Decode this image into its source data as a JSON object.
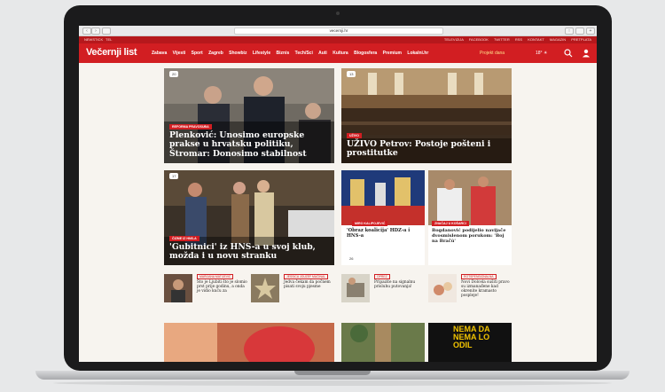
{
  "browser": {
    "url": "vecernji.hr"
  },
  "topbar": {
    "left": "NEWSTICK",
    "left2": "TEL",
    "right": [
      "TELEVIZIJA",
      "FACEBOOK",
      "TWITTER",
      "RSS",
      "KONTAKT",
      "MAGAZIN",
      "PRETPLATA"
    ]
  },
  "header": {
    "logo": "Večernji list",
    "nav": [
      "Zabava",
      "Vijesti",
      "Sport",
      "Zagreb",
      "Showbiz",
      "Lifestyle",
      "Biznis",
      "Tech/Sci",
      "Auti",
      "Kultura",
      "Blogosfera",
      "Premium",
      "Lokalni.hr"
    ],
    "projekt": "Projekt dana",
    "weather": "18°"
  },
  "articles": {
    "a1": {
      "tag": "REFORMA PRAVOSUĐA",
      "title": "Plenković: Unosimo europske prakse u hrvatsku politiku, Štromar: Donosimo stabilnost",
      "count": "20"
    },
    "a2": {
      "tag": "UŽIVO",
      "title": "UŽIVO Petrov: Postoje pošteni i prostitutke",
      "count": "13"
    },
    "a3": {
      "tag": "ČIZME IZ HNS-A",
      "title": "'Gubitnici' iz HNS-a u svoj klub, možda i u novu stranku",
      "count": "17"
    },
    "a4": {
      "tag": "MIRO KALIPOJEVIĆ",
      "title": "'Obraz koalicija' HDZ-a i HNS-a",
      "count": "26"
    },
    "a5": {
      "tag": "ZNAČAJ U KOŠARCI",
      "title": "Bogdanović podijelio navijače dvosmislenom porukom: 'Boj na Bračú'"
    }
  },
  "mini": [
    {
      "tag": "MARIJANA MATIJEVIĆ",
      "title": "Što je Ljubiti što je slomio prst prije godinu, a onda je vidio kuću za"
    },
    {
      "tag": "JESSICA JOUZEF MAČINAL",
      "title": "Jedva čekam da počnem pisati svoju pjesme"
    },
    {
      "tag": "OPREZ",
      "title": "Pripazite na signalnu prisluhu putovanja!",
      "count": "5"
    },
    {
      "tag": "ROTSPENSIONALNA",
      "title": "Novi Dolcela sušiti pravo su izmanađene kad okrenite kramasto pospleje!"
    }
  ],
  "bottom": {
    "banner_text": "NEMA DA NEMA LO ODIL"
  },
  "colors": {
    "brand": "#d21e22",
    "topbar": "#b6181c",
    "bg": "#f7f4ef"
  }
}
